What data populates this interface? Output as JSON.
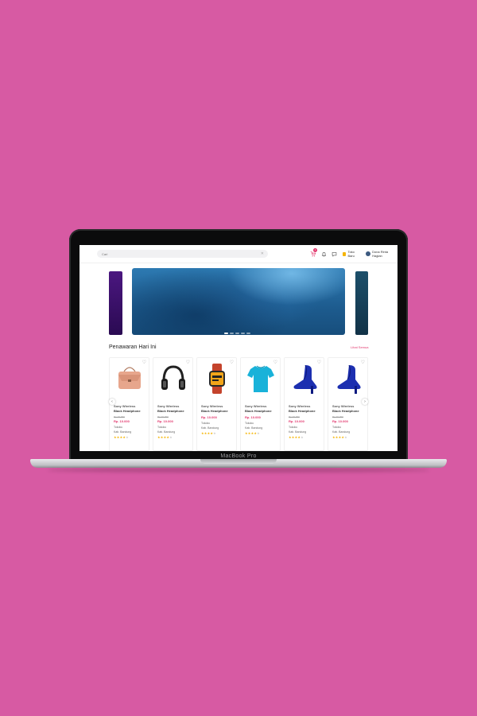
{
  "device": {
    "label": "MacBook Pro"
  },
  "header": {
    "search": {
      "value": "",
      "placeholder": "Cari"
    },
    "cart_count": "1",
    "store_label": "Toko Baru",
    "profile_name": "Dona Rinta Hagian"
  },
  "carousel": {
    "slides": 5,
    "active": 0
  },
  "section": {
    "title": "Penawaran Hari Ini",
    "see_all": "Lihat Semua"
  },
  "products": [
    {
      "name1": "Sony Wireless",
      "name2": "Black Headphone",
      "old_price": "Rp 20.000",
      "price": "Rp. 10.000",
      "store": "Tokoku",
      "location": "Kab. Bandung",
      "rating": 4,
      "image": "bag"
    },
    {
      "name1": "Sony Wireless",
      "name2": "Black Headphone",
      "old_price": "Rp 20.000",
      "price": "Rp. 10.000",
      "store": "Tokoku",
      "location": "Kab. Bandung",
      "rating": 4,
      "image": "headphone"
    },
    {
      "name1": "Sony Wireless",
      "name2": "Black Headphone",
      "old_price": "",
      "price": "Rp. 10.000",
      "store": "Tokoku",
      "location": "Kab. Bandung",
      "rating": 4,
      "image": "watch"
    },
    {
      "name1": "Sony Wireless",
      "name2": "Black Headphone",
      "old_price": "",
      "price": "Rp. 10.000",
      "store": "Tokoku",
      "location": "Kab. Bandung",
      "rating": 4,
      "image": "tshirt"
    },
    {
      "name1": "Sony Wireless",
      "name2": "Black Headphone",
      "old_price": "Rp 20.000",
      "price": "Rp. 10.000",
      "store": "Tokoku",
      "location": "Kab. Bandung",
      "rating": 4,
      "image": "heel"
    },
    {
      "name1": "Sony Wireless",
      "name2": "Black Headphone",
      "old_price": "Rp 20.000",
      "price": "Rp. 10.000",
      "store": "Tokoku",
      "location": "Kab. Bandung",
      "rating": 4,
      "image": "heel"
    }
  ],
  "colors": {
    "background": "#d75aa3",
    "accent": "#e2376d",
    "star": "#f5b400"
  },
  "icons": {
    "cart": "cart-icon",
    "bell": "bell-icon",
    "chat": "chat-icon",
    "store": "store-icon",
    "prev": "chevron-left-icon",
    "next": "chevron-right-icon",
    "wishlist": "heart-icon"
  }
}
